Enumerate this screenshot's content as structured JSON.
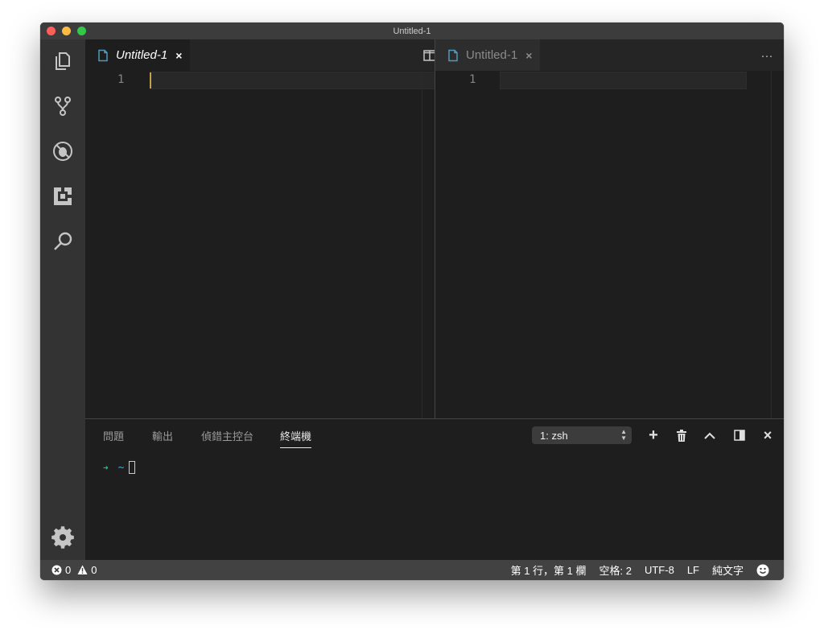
{
  "window": {
    "title": "Untitled-1"
  },
  "activity_bar": {
    "items": [
      "explorer-icon",
      "source-control-icon",
      "debug-icon",
      "extensions-icon",
      "search-icon"
    ],
    "bottom": "settings-gear-icon"
  },
  "editor_groups": [
    {
      "tab": {
        "label": "Untitled-1",
        "close": "×"
      },
      "actions": {
        "split": "split-editor-icon",
        "more": "···"
      },
      "line_numbers": [
        "1"
      ]
    },
    {
      "tab": {
        "label": "Untitled-1",
        "close": "×"
      },
      "actions": {
        "more": "···"
      },
      "line_numbers": [
        "1"
      ]
    }
  ],
  "panel": {
    "tabs": [
      "問題",
      "輸出",
      "偵錯主控台",
      "終端機"
    ],
    "active_tab": "終端機",
    "terminal_select": "1: zsh",
    "actions": {
      "add": "+",
      "close": "×"
    },
    "prompt": {
      "arrow": "➜",
      "path": "~"
    }
  },
  "status_bar": {
    "errors": "0",
    "warnings": "0",
    "position": "第 1 行，第 1 欄",
    "indent": "空格: 2",
    "encoding": "UTF-8",
    "eol": "LF",
    "language": "純文字"
  },
  "colors": {
    "accent_file_icon": "#519aba",
    "cursor_line": "#282828",
    "terminal_arrow": "#2fbe9a",
    "terminal_path": "#2fb3e7"
  }
}
